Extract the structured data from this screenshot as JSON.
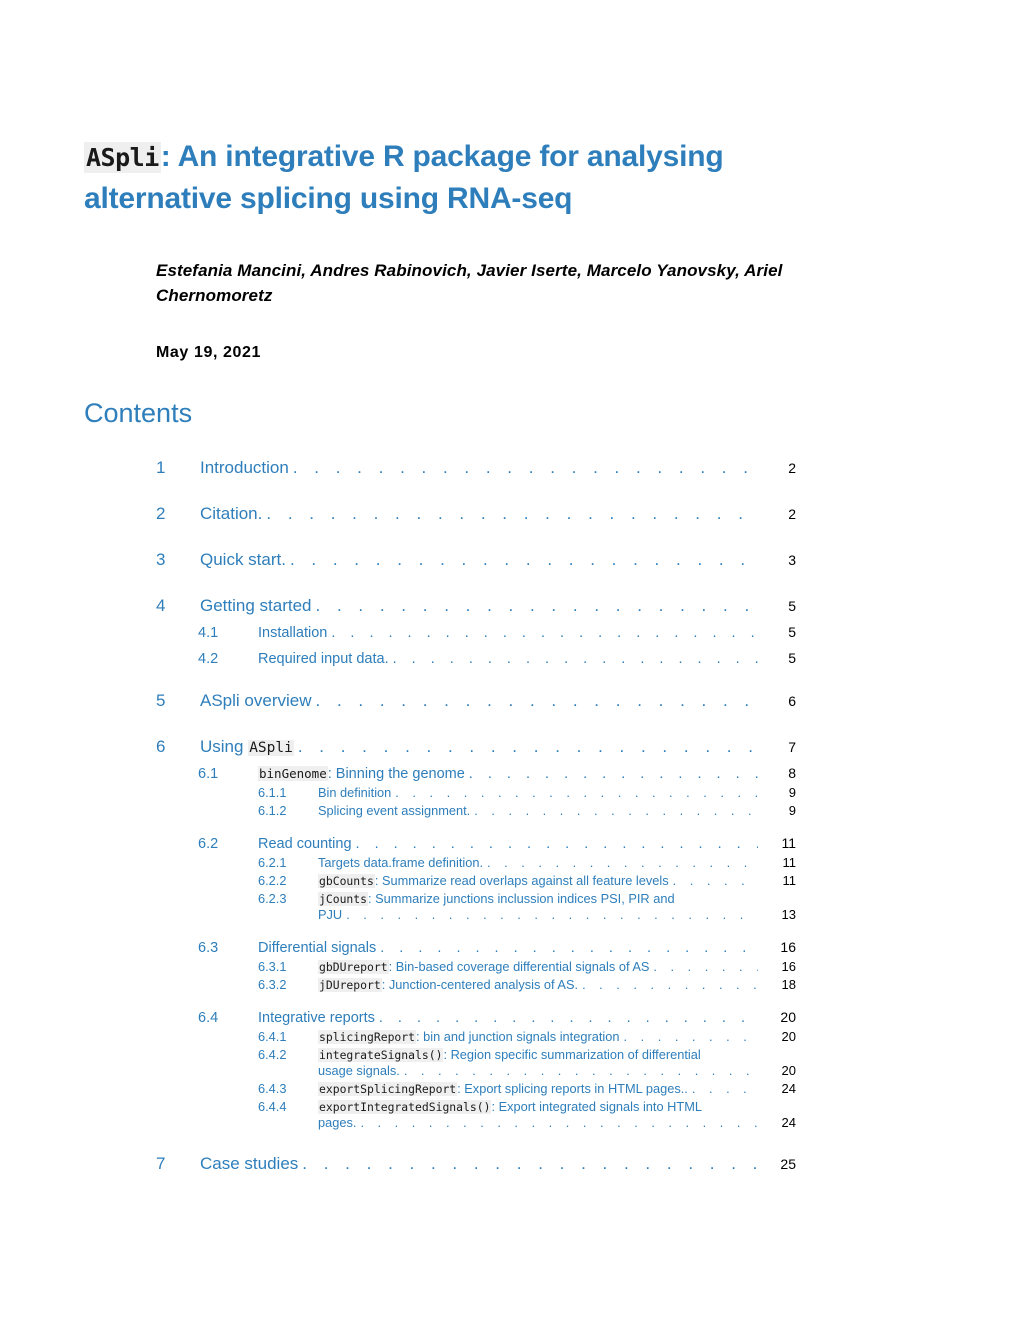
{
  "document": {
    "title": {
      "code_part": "ASpli",
      "colon": ":",
      "rest": " An integrative R package for analysing alternative splicing using RNA-seq"
    },
    "authors": "Estefania Mancini, Andres Rabinovich, Javier Iserte, Marcelo Yanovsky, Ariel Chernomoretz",
    "date": "May 19, 2021",
    "contents_heading": "Contents",
    "colors": {
      "link_blue": "#2e7ebb",
      "code_background": "#efefef",
      "code_text": "#1a1a1a",
      "page_number": "#000000"
    }
  },
  "toc": {
    "entries": [
      {
        "level": 1,
        "number": "1",
        "title": "Introduction",
        "page": "2"
      },
      {
        "level": 1,
        "number": "2",
        "title": "Citation.",
        "page": "2"
      },
      {
        "level": 1,
        "number": "3",
        "title": "Quick start.",
        "page": "3"
      },
      {
        "level": 1,
        "number": "4",
        "title": "Getting started",
        "page": "5"
      },
      {
        "level": 2,
        "number": "4.1",
        "title": "Installation",
        "page": "5"
      },
      {
        "level": 2,
        "number": "4.2",
        "title": "Required input data.",
        "page": "5"
      },
      {
        "level": 1,
        "number": "5",
        "title": "ASpli overview",
        "page": "6"
      },
      {
        "level": 1,
        "number": "6",
        "title_prefix": "Using ",
        "code": "ASpli",
        "title": "Using ASpli",
        "page": "7"
      },
      {
        "level": 2,
        "number": "6.1",
        "code": "binGenome",
        "title_suffix": ": Binning the genome",
        "title": "binGenome: Binning the genome",
        "page": "8"
      },
      {
        "level": 3,
        "number": "6.1.1",
        "title": "Bin definition",
        "page": "9"
      },
      {
        "level": 3,
        "number": "6.1.2",
        "title": "Splicing event assignment.",
        "page": "9"
      },
      {
        "level": 2,
        "number": "6.2",
        "title": "Read counting",
        "page": "11"
      },
      {
        "level": 3,
        "number": "6.2.1",
        "title": "Targets data.frame definition.",
        "page": "11"
      },
      {
        "level": 3,
        "number": "6.2.2",
        "code": "gbCounts",
        "title_suffix": ": Summarize read overlaps against all feature levels",
        "title": "gbCounts: Summarize read overlaps against all feature levels",
        "page": "11"
      },
      {
        "level": 3,
        "number": "6.2.3",
        "code": "jCounts",
        "title_suffix": ":  Summarize  junctions  inclussion  indices  PSI,  PIR  and",
        "continuation": "PJU",
        "title": "jCounts: Summarize junctions inclussion indices PSI, PIR and PJU",
        "page": "13"
      },
      {
        "level": 2,
        "number": "6.3",
        "title": "Differential signals",
        "page": "16"
      },
      {
        "level": 3,
        "number": "6.3.1",
        "code": "gbDUreport",
        "title_suffix": ": Bin-based coverage differential signals of AS",
        "title": "gbDUreport: Bin-based coverage differential signals of AS",
        "page": "16"
      },
      {
        "level": 3,
        "number": "6.3.2",
        "code": "jDUreport",
        "title_suffix": ": Junction-centered analysis of AS.",
        "title": "jDUreport: Junction-centered analysis of AS.",
        "page": "18"
      },
      {
        "level": 2,
        "number": "6.4",
        "title": "Integrative reports",
        "page": "20"
      },
      {
        "level": 3,
        "number": "6.4.1",
        "code": "splicingReport",
        "title_suffix": ": bin and junction signals integration",
        "title": "splicingReport: bin and junction signals integration",
        "page": "20"
      },
      {
        "level": 3,
        "number": "6.4.2",
        "code": "integrateSignals()",
        "title_suffix": ": Region specific summarization of differential",
        "continuation": "usage signals.",
        "title": "integrateSignals(): Region specific summarization of differential usage signals.",
        "page": "20"
      },
      {
        "level": 3,
        "number": "6.4.3",
        "code": "exportSplicingReport",
        "title_suffix": ": Export splicing reports in HTML pages..",
        "title": "exportSplicingReport: Export splicing reports in HTML pages..",
        "page": "24"
      },
      {
        "level": 3,
        "number": "6.4.4",
        "code": "exportIntegratedSignals()",
        "title_suffix": ": Export integrated signals into HTML",
        "continuation": "pages.",
        "title": "exportIntegratedSignals(): Export integrated signals into HTML pages.",
        "page": "24"
      },
      {
        "level": 1,
        "number": "7",
        "title": "Case studies",
        "page": "25"
      }
    ]
  }
}
